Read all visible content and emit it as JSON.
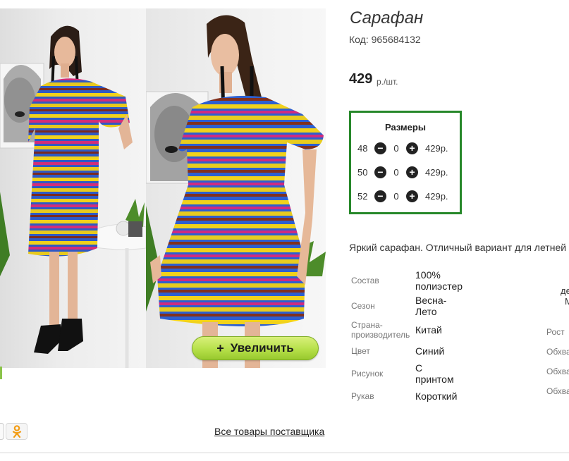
{
  "product": {
    "title": "Сарафан",
    "code": "Код: 965684132",
    "price": "429",
    "price_unit": "р./шт.",
    "description": "Яркий сарафан. Отличный вариант для летней"
  },
  "gallery": {
    "zoom_label": "Увеличить",
    "zoom_icon": "plus-icon"
  },
  "sizes": {
    "title": "Размеры",
    "rows": [
      {
        "size": "48",
        "qty": "0",
        "price": "429р."
      },
      {
        "size": "50",
        "qty": "0",
        "price": "429р."
      },
      {
        "size": "52",
        "qty": "0",
        "price": "429р."
      }
    ]
  },
  "attributes": [
    {
      "label": "Состав",
      "value_lines": [
        "100%",
        "полиэстер"
      ]
    },
    {
      "label": "Сезон",
      "value_lines": [
        "Весна-",
        "Лето"
      ]
    },
    {
      "label_lines": [
        "Страна-",
        "производитель"
      ],
      "value_lines": [
        "Китай"
      ]
    },
    {
      "label": "Цвет",
      "value_lines": [
        "Синий"
      ]
    },
    {
      "label": "Рисунок",
      "value_lines": [
        "С",
        "принтом"
      ]
    },
    {
      "label": "Рукав",
      "value_lines": [
        "Короткий"
      ]
    }
  ],
  "right_column": {
    "partial_1": "де",
    "partial_2": "М",
    "items": [
      "Рост",
      "Обхва",
      "Обхва",
      "Обхва"
    ]
  },
  "footer": {
    "all_goods_link": "Все товары поставщика",
    "social_icon": "odnoklassniki-icon"
  },
  "colors": {
    "accent_green": "#27882a",
    "zoom_button": "#b6e04a"
  }
}
